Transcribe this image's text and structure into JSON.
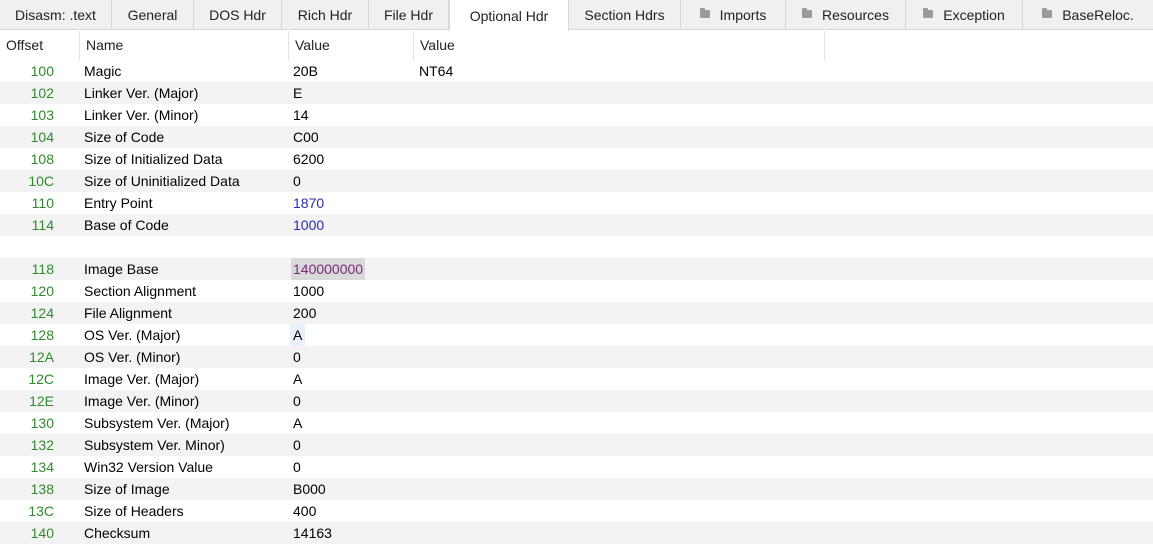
{
  "tabs": [
    {
      "label": "Disasm: .text",
      "folder": false
    },
    {
      "label": "General",
      "folder": false
    },
    {
      "label": "DOS Hdr",
      "folder": false
    },
    {
      "label": "Rich Hdr",
      "folder": false
    },
    {
      "label": "File Hdr",
      "folder": false
    },
    {
      "label": "Optional Hdr",
      "folder": false,
      "active": true
    },
    {
      "label": "Section Hdrs",
      "folder": false
    },
    {
      "label": "Imports",
      "folder": true
    },
    {
      "label": "Resources",
      "folder": true
    },
    {
      "label": "Exception",
      "folder": true
    },
    {
      "label": "BaseReloc.",
      "folder": true
    }
  ],
  "columns": {
    "offset": "Offset",
    "name": "Name",
    "value": "Value",
    "value2": "Value"
  },
  "rows": [
    {
      "offset": "100",
      "name": "Magic",
      "value": "20B",
      "value2": "NT64"
    },
    {
      "offset": "102",
      "name": "Linker Ver. (Major)",
      "value": "E",
      "value2": ""
    },
    {
      "offset": "103",
      "name": "Linker Ver. (Minor)",
      "value": "14",
      "value2": ""
    },
    {
      "offset": "104",
      "name": "Size of Code",
      "value": "C00",
      "value2": ""
    },
    {
      "offset": "108",
      "name": "Size of Initialized Data",
      "value": "6200",
      "value2": ""
    },
    {
      "offset": "10C",
      "name": "Size of Uninitialized Data",
      "value": "0",
      "value2": ""
    },
    {
      "offset": "110",
      "name": "Entry Point",
      "value": "1870",
      "value2": ""
    },
    {
      "offset": "114",
      "name": "Base of Code",
      "value": "1000",
      "value2": ""
    },
    {
      "offset": "",
      "name": "",
      "value": "",
      "value2": ""
    },
    {
      "offset": "118",
      "name": "Image Base",
      "value": "140000000",
      "value2": ""
    },
    {
      "offset": "120",
      "name": "Section Alignment",
      "value": "1000",
      "value2": ""
    },
    {
      "offset": "124",
      "name": "File Alignment",
      "value": "200",
      "value2": ""
    },
    {
      "offset": "128",
      "name": "OS Ver. (Major)",
      "value": "A",
      "value2": ""
    },
    {
      "offset": "12A",
      "name": "OS Ver. (Minor)",
      "value": "0",
      "value2": ""
    },
    {
      "offset": "12C",
      "name": "Image Ver. (Major)",
      "value": "A",
      "value2": ""
    },
    {
      "offset": "12E",
      "name": "Image Ver. (Minor)",
      "value": "0",
      "value2": ""
    },
    {
      "offset": "130",
      "name": "Subsystem Ver. (Major)",
      "value": "A",
      "value2": ""
    },
    {
      "offset": "132",
      "name": "Subsystem Ver. Minor)",
      "value": "0",
      "value2": ""
    },
    {
      "offset": "134",
      "name": "Win32 Version Value",
      "value": "0",
      "value2": ""
    },
    {
      "offset": "138",
      "name": "Size of Image",
      "value": "B000",
      "value2": ""
    },
    {
      "offset": "13C",
      "name": "Size of Headers",
      "value": "400",
      "value2": ""
    },
    {
      "offset": "140",
      "name": "Checksum",
      "value": "14163",
      "value2": ""
    }
  ],
  "colors": {
    "offset": "#2f8a2f",
    "link": "#2b2bb8",
    "selected_text": "#7a2b7a",
    "row_alt": "#f3f3f3"
  }
}
